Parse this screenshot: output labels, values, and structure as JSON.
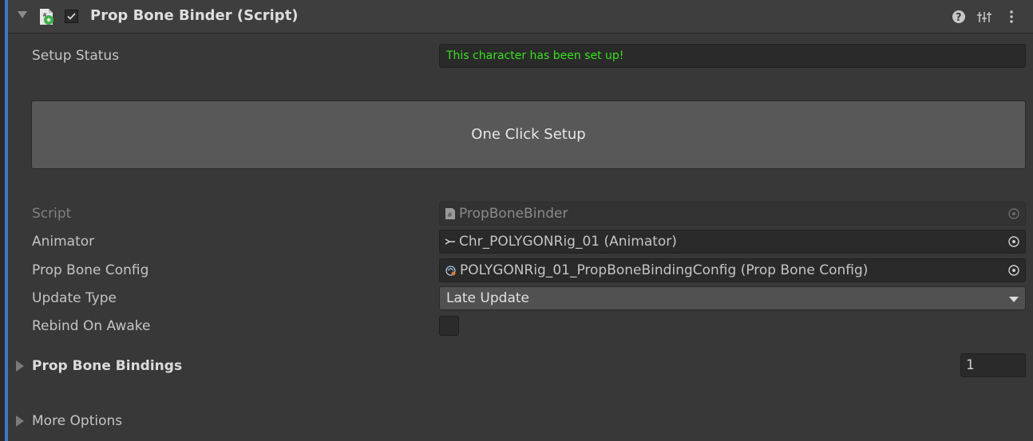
{
  "component": {
    "title": "Prop Bone Binder (Script)",
    "enabled": true
  },
  "setup_status": {
    "label": "Setup Status",
    "value": "This character has been set up!",
    "value_color": "#38e21f"
  },
  "setup_button": {
    "label": "One Click Setup"
  },
  "fields": {
    "script": {
      "label": "Script",
      "value": "PropBoneBinder",
      "icon": "cs-script-icon"
    },
    "animator": {
      "label": "Animator",
      "value": "Chr_POLYGONRig_01 (Animator)",
      "icon": "animator-icon"
    },
    "prop_bone_config": {
      "label": "Prop Bone Config",
      "value": "POLYGONRig_01_PropBoneBindingConfig (Prop Bone Config)",
      "icon": "scriptable-object-icon"
    },
    "update_type": {
      "label": "Update Type",
      "value": "Late Update"
    },
    "rebind_on_awake": {
      "label": "Rebind On Awake",
      "checked": false
    }
  },
  "prop_bone_bindings": {
    "label": "Prop Bone Bindings",
    "count": "1"
  },
  "more_options": {
    "label": "More Options"
  },
  "colors": {
    "background": "#383838",
    "accent": "#3b79c4",
    "field": "#2a2a2a",
    "button": "#585858"
  }
}
